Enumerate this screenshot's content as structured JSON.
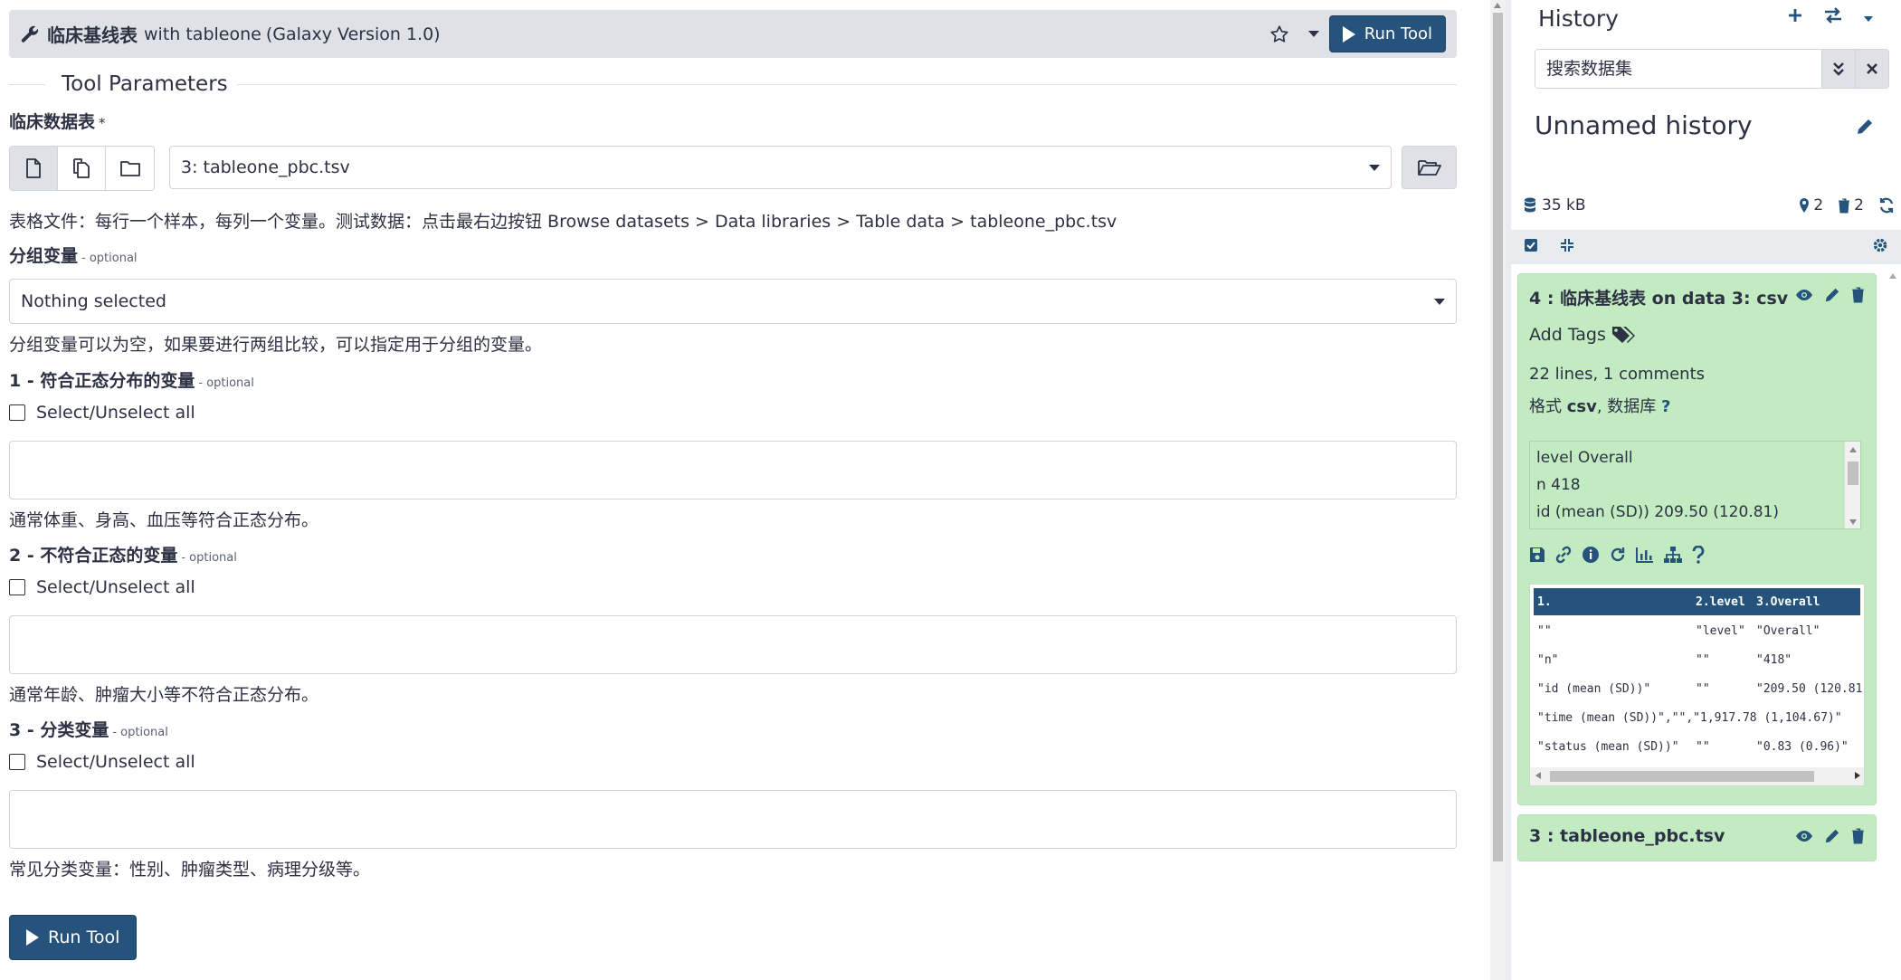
{
  "tool": {
    "name": "临床基线表",
    "description": "with tableone",
    "version": "(Galaxy Version 1.0)",
    "run_label": "Run Tool"
  },
  "section_title": "Tool Parameters",
  "params": {
    "clinical_table": {
      "label": "临床数据表",
      "required_mark": "*",
      "selected": "3: tableone_pbc.tsv",
      "help": "表格文件：每行一个样本，每列一个变量。测试数据：点击最右边按钮 Browse datasets > Data libraries > Table data > tableone_pbc.tsv"
    },
    "group_var": {
      "label": "分组变量",
      "optional": "- optional",
      "selected": "Nothing selected",
      "help": "分组变量可以为空，如果要进行两组比较，可以指定用于分组的变量。"
    },
    "normal_vars": {
      "label": "1 - 符合正态分布的变量",
      "optional": "- optional",
      "select_all": "Select/Unselect all",
      "help": "通常体重、身高、血压等符合正态分布。"
    },
    "nonnormal_vars": {
      "label": "2 - 不符合正态的变量",
      "optional": "- optional",
      "select_all": "Select/Unselect all",
      "help": "通常年龄、肿瘤大小等不符合正态分布。"
    },
    "categorical_vars": {
      "label": "3 - 分类变量",
      "optional": "- optional",
      "select_all": "Select/Unselect all",
      "help": "常见分类变量：性别、肿瘤类型、病理分级等。"
    }
  },
  "history": {
    "title": "History",
    "search_placeholder": "搜索数据集",
    "name": "Unnamed history",
    "size": "35 kB",
    "shown_count": "2",
    "deleted_count": "2",
    "datasets": [
      {
        "title": "4 : 临床基线表 on data 3: csv",
        "add_tags": "Add Tags",
        "info_lines": "22 lines, 1 comments",
        "format_prefix": "格式 ",
        "format": "csv",
        "db_prefix": ", 数据库 ",
        "db": "?",
        "peek_lines": [
          "level Overall",
          "n 418",
          "id (mean (SD)) 209.50 (120.81)"
        ],
        "table": {
          "headers": [
            "1.",
            "2.level",
            "3.Overall"
          ],
          "rows": [
            [
              "\"\"",
              "\"level\"",
              "\"Overall\""
            ],
            [
              "\"n\"",
              "\"\"",
              "\"418\""
            ],
            [
              "\"id (mean (SD))\"",
              "\"\"",
              "\"209.50 (120.81"
            ],
            [
              "\"time (mean (SD))\",\"\",\"1,917.78 (1,104.67)\"",
              "",
              ""
            ],
            [
              "\"status (mean (SD))\"",
              "\"\"",
              "\"0.83 (0.96)\""
            ]
          ]
        }
      },
      {
        "title": "3 : tableone_pbc.tsv"
      }
    ]
  },
  "colors": {
    "primary": "#25537b",
    "dataset_ok": "#c2ebc2",
    "header_bg": "#dee2e6"
  }
}
